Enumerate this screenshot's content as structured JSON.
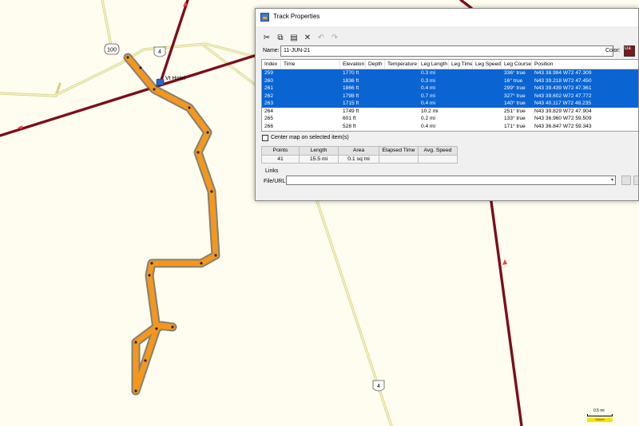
{
  "map": {
    "shields": [
      "100",
      "4",
      "4",
      "4"
    ],
    "poi_label": "Vt Hotel",
    "colors": {
      "background": "#fefdf0",
      "route_dark": "#7a0f1a",
      "route_light": "#ede9a2",
      "track": "#f5971c"
    }
  },
  "dialog": {
    "title": "Track Properties",
    "toolbar": [
      "cut-icon",
      "copy-icon",
      "paste-icon",
      "delete-icon",
      "undo-icon",
      "redo-icon"
    ],
    "name_label": "Name:",
    "name_value": "11-JUN-21",
    "color_label": "Color:",
    "color_value_text": "Da",
    "color_value": "#7a1a1a",
    "columns": [
      "Index",
      "Time",
      "Elevation",
      "Depth",
      "Temperature",
      "Leg Length",
      "Leg Time",
      "Leg Speed",
      "Leg Course",
      "Position"
    ],
    "rows": [
      {
        "index": "259",
        "time": "",
        "elevation": "1770 ft",
        "depth": "",
        "temperature": "",
        "leg_length": "0.3 mi",
        "leg_time": "",
        "leg_speed": "",
        "leg_course": "336° true",
        "position": "N43 38.984 W72 47.309",
        "selected": true
      },
      {
        "index": "260",
        "time": "",
        "elevation": "1836 ft",
        "depth": "",
        "temperature": "",
        "leg_length": "0.3 mi",
        "leg_time": "",
        "leg_speed": "",
        "leg_course": "16° true",
        "position": "N43 39.218 W72 47.450",
        "selected": true
      },
      {
        "index": "261",
        "time": "",
        "elevation": "1866 ft",
        "depth": "",
        "temperature": "",
        "leg_length": "0.4 mi",
        "leg_time": "",
        "leg_speed": "",
        "leg_course": "299° true",
        "position": "N43 39.439 W72 47.361",
        "selected": true
      },
      {
        "index": "262",
        "time": "",
        "elevation": "1798 ft",
        "depth": "",
        "temperature": "",
        "leg_length": "0.7 mi",
        "leg_time": "",
        "leg_speed": "",
        "leg_course": "327° true",
        "position": "N43 39.602 W72 47.772",
        "selected": true
      },
      {
        "index": "263",
        "time": "",
        "elevation": "1715 ft",
        "depth": "",
        "temperature": "",
        "leg_length": "0.4 mi",
        "leg_time": "",
        "leg_speed": "",
        "leg_course": "140° true",
        "position": "N43 40.117 W72 48.235",
        "selected": true
      },
      {
        "index": "264",
        "time": "",
        "elevation": "1749 ft",
        "depth": "",
        "temperature": "",
        "leg_length": "10.2 mi",
        "leg_time": "",
        "leg_speed": "",
        "leg_course": "251° true",
        "position": "N43 39.829 W72 47.904",
        "selected": false
      },
      {
        "index": "265",
        "time": "",
        "elevation": "601 ft",
        "depth": "",
        "temperature": "",
        "leg_length": "0.2 mi",
        "leg_time": "",
        "leg_speed": "",
        "leg_course": "133° true",
        "position": "N43 36.960 W72 59.509",
        "selected": false
      },
      {
        "index": "266",
        "time": "",
        "elevation": "528 ft",
        "depth": "",
        "temperature": "",
        "leg_length": "0.4 mi",
        "leg_time": "",
        "leg_speed": "",
        "leg_course": "171° true",
        "position": "N43 36.847 W72 59.343",
        "selected": false
      }
    ],
    "center_map_label": "Center map on selected item(s)",
    "center_map_checked": false,
    "stats": {
      "headers": [
        "Points",
        "Length",
        "Area",
        "Elapsed Time",
        "Avg. Speed"
      ],
      "values": [
        "41",
        "15.5 mi",
        "0.1 sq mi",
        "",
        ""
      ]
    },
    "links_label": "Links",
    "file_url_label": "File/URL:",
    "file_url_value": "",
    "selection_color": "#0a64d2"
  },
  "scale": {
    "label": "0.5 mi",
    "credit": "Garmin"
  }
}
